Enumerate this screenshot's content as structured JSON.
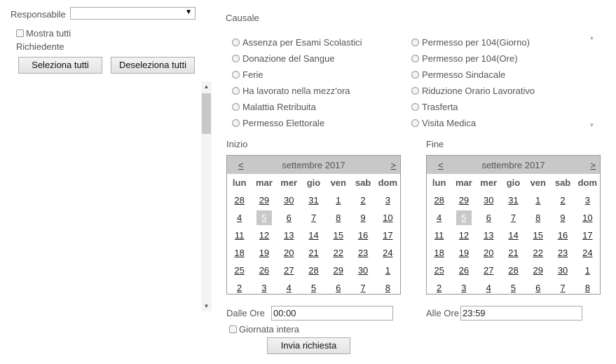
{
  "filters": {
    "responsabile_label": "Responsabile",
    "responsabile_value": "",
    "mostra_tutti_label": "Mostra tutti",
    "richiedente_label": "Richiedente",
    "seleziona_tutti": "Seleziona tutti",
    "deseleziona_tutti": "Deseleziona tutti"
  },
  "causale": {
    "label": "Causale",
    "options_left": [
      "Assenza per Esami Scolastici",
      "Donazione del Sangue",
      "Ferie",
      "Ha lavorato nella mezz'ora",
      "Malattia Retribuita",
      "Permesso Elettorale"
    ],
    "options_right": [
      "Permesso per 104(Giorno)",
      "Permesso per 104(Ore)",
      "Permesso Sindacale",
      "Riduzione Orario Lavorativo",
      "Trasferta",
      "Visita Medica"
    ]
  },
  "calendars": [
    {
      "label": "Inizio",
      "month": "settembre 2017",
      "prev": "<",
      "next": ">",
      "weekdays": [
        "lun",
        "mar",
        "mer",
        "gio",
        "ven",
        "sab",
        "dom"
      ],
      "weeks": [
        [
          "28",
          "29",
          "30",
          "31",
          "1",
          "2",
          "3"
        ],
        [
          "4",
          "5",
          "6",
          "7",
          "8",
          "9",
          "10"
        ],
        [
          "11",
          "12",
          "13",
          "14",
          "15",
          "16",
          "17"
        ],
        [
          "18",
          "19",
          "20",
          "21",
          "22",
          "23",
          "24"
        ],
        [
          "25",
          "26",
          "27",
          "28",
          "29",
          "30",
          "1"
        ],
        [
          "2",
          "3",
          "4",
          "5",
          "6",
          "7",
          "8"
        ]
      ],
      "selected": "5"
    },
    {
      "label": "Fine",
      "month": "settembre 2017",
      "prev": "<",
      "next": ">",
      "weekdays": [
        "lun",
        "mar",
        "mer",
        "gio",
        "ven",
        "sab",
        "dom"
      ],
      "weeks": [
        [
          "28",
          "29",
          "30",
          "31",
          "1",
          "2",
          "3"
        ],
        [
          "4",
          "5",
          "6",
          "7",
          "8",
          "9",
          "10"
        ],
        [
          "11",
          "12",
          "13",
          "14",
          "15",
          "16",
          "17"
        ],
        [
          "18",
          "19",
          "20",
          "21",
          "22",
          "23",
          "24"
        ],
        [
          "25",
          "26",
          "27",
          "28",
          "29",
          "30",
          "1"
        ],
        [
          "2",
          "3",
          "4",
          "5",
          "6",
          "7",
          "8"
        ]
      ],
      "selected": "5"
    }
  ],
  "time": {
    "dalle_label": "Dalle Ore",
    "dalle_value": "00:00",
    "alle_label": "Alle Ore",
    "alle_value": "23:59",
    "giornata_label": "Giornata intera"
  },
  "submit": "Invia richiesta",
  "icons": {
    "dropdown": "chevron-down-icon",
    "scroll_up": "scroll-up-icon",
    "scroll_down": "scroll-down-icon"
  }
}
